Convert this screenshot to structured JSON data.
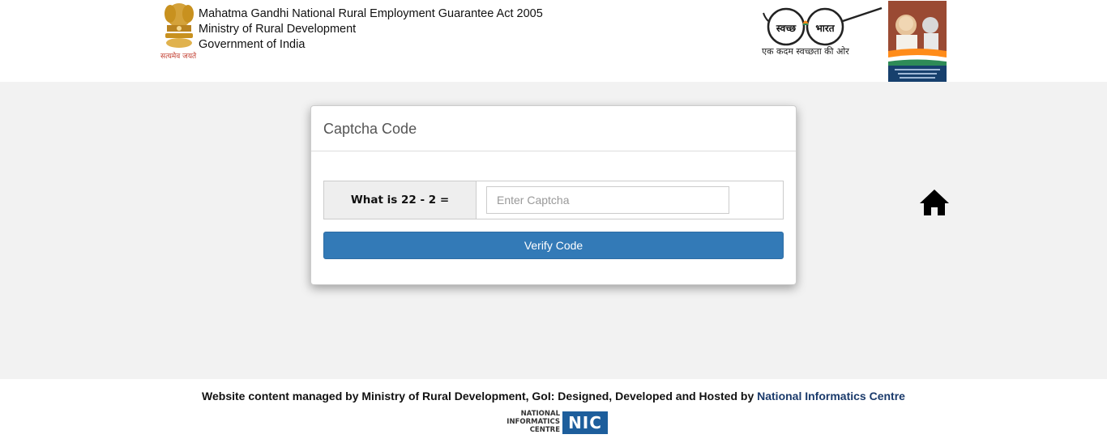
{
  "header": {
    "title_line1": "Mahatma Gandhi National Rural Employment Guarantee Act 2005",
    "title_line2": "Ministry of Rural Development",
    "title_line3": "Government of India",
    "emblem_motto": "सत्यमेव जयते",
    "swachh_word1": "स्वच्छ",
    "swachh_word2": "भारत",
    "swachh_tagline": "एक कदम स्वच्छता की ओर"
  },
  "captcha_panel": {
    "title": "Captcha Code",
    "question": "What is 22 - 2 =",
    "input_placeholder": "Enter Captcha",
    "input_value": "",
    "verify_label": "Verify Code"
  },
  "footer": {
    "text": "Website content managed by Ministry of Rural Development, GoI: Designed, Developed and Hosted by ",
    "link_text": "National Informatics Centre",
    "nic_line1": "NATIONAL",
    "nic_line2": "INFORMATICS",
    "nic_line3": "CENTRE",
    "nic_mark": "NIC"
  },
  "icons": {
    "home": "home-icon",
    "emblem": "national-emblem-icon",
    "swachh_logo": "swachh-bharat-glasses-icon",
    "gandhi_image": "gandhi-portrait-icon"
  },
  "colors": {
    "primary_button": "#337ab7",
    "background": "#f2f2f2",
    "link": "#1a3a6b"
  }
}
